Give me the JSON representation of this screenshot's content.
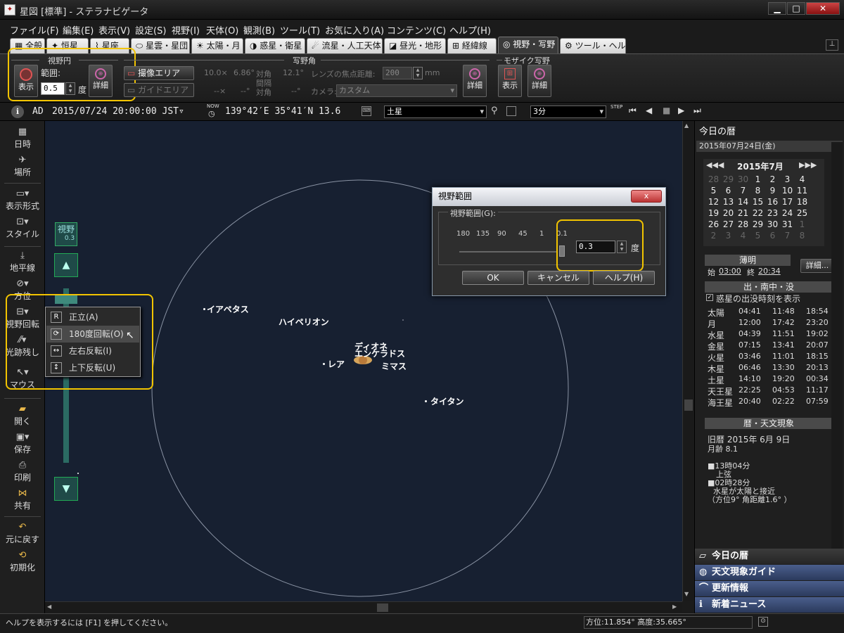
{
  "window": {
    "title": "星図 [標準] - ステラナビゲータ",
    "min": "▁",
    "max": "□",
    "close": "✕"
  },
  "menu": [
    "ファイル(F)",
    "編集(E)",
    "表示(V)",
    "設定(S)",
    "視野(I)",
    "天体(O)",
    "観測(B)",
    "ツール(T)",
    "お気に入り(A)",
    "コンテンツ(C)",
    "ヘルプ(H)"
  ],
  "tabs": [
    "全般",
    "恒星",
    "星座",
    "星雲・星団",
    "太陽・月",
    "惑星・衛星",
    "流星・人工天体",
    "昼光・地形",
    "経緯線",
    "視野・写野",
    "ツール・ヘルプ"
  ],
  "ribbon": {
    "fov_circle": {
      "title": "視野円",
      "show": "表示",
      "range_label": "範囲:",
      "range_value": "0.5",
      "unit": "度",
      "detail": "詳細"
    },
    "photo": {
      "title": "写野角",
      "imaging_area": "撮像エリア",
      "guide_area": "ガイドエリア",
      "v1": "10.0×",
      "v2": "6.86°",
      "v3": "対角",
      "v4": "12.1°",
      "d1": "--×",
      "d2": "--°",
      "d3": "間隔",
      "d3b": "対角",
      "d4": "--°",
      "focal_label": "レンズの焦点距離:",
      "focal_value": "200",
      "focal_unit": "mm",
      "camera_label": "カメラ:",
      "camera_value": "カスタム",
      "detail": "詳細"
    },
    "mosaic": {
      "title": "モザイク写野",
      "show": "表示",
      "detail": "詳細"
    }
  },
  "status_row": {
    "era": "AD",
    "datetime": "2015/07/24 20:00:00 JST▿",
    "now": "NOW",
    "coords": "139°42′E 35°41′N 13.6",
    "object": "土星",
    "step": "3分",
    "step_label": "STEP"
  },
  "left_tools": [
    "日時",
    "場所",
    "表示形式",
    "スタイル",
    "地平線",
    "方位",
    "視野回転",
    "光跡残し",
    "マウス",
    "開く",
    "保存",
    "印刷",
    "共有",
    "元に戻す",
    "初期化"
  ],
  "view_slider": {
    "label": "視野",
    "value": "0.3"
  },
  "sky_labels": [
    {
      "name": "イアペタス"
    },
    {
      "name": "ハイペリオン"
    },
    {
      "name": "ディオネ"
    },
    {
      "name": "エンケラドス"
    },
    {
      "name": "レア"
    },
    {
      "name": "ミマス"
    },
    {
      "name": "タイタン"
    }
  ],
  "context_menu": [
    {
      "label": "正立(A)",
      "icon": "upright-icon"
    },
    {
      "label": "180度回転(O)",
      "icon": "rotate-180-icon"
    },
    {
      "label": "左右反転(I)",
      "icon": "flip-horizontal-icon"
    },
    {
      "label": "上下反転(U)",
      "icon": "flip-vertical-icon"
    }
  ],
  "dialog": {
    "title": "視野範囲",
    "group": "視野範囲(G):",
    "ticks": [
      "180",
      "135",
      "90",
      "45",
      "1",
      "0.1"
    ],
    "value": "0.3",
    "unit": "度",
    "ok": "OK",
    "cancel": "キャンセル",
    "help": "ヘルプ(H)",
    "close": "x"
  },
  "right": {
    "title": "今日の暦",
    "date": "2015年07月24日(金)",
    "month": "2015年7月",
    "calendar": [
      [
        "28",
        "29",
        "30",
        "1",
        "2",
        "3",
        "4"
      ],
      [
        "5",
        "6",
        "7",
        "8",
        "9",
        "10",
        "11"
      ],
      [
        "12",
        "13",
        "14",
        "15",
        "16",
        "17",
        "18"
      ],
      [
        "19",
        "20",
        "21",
        "22",
        "23",
        "24",
        "25"
      ],
      [
        "26",
        "27",
        "28",
        "29",
        "30",
        "31",
        "1"
      ],
      [
        "2",
        "3",
        "4",
        "5",
        "6",
        "7",
        "8"
      ]
    ],
    "twilight_title": "薄明",
    "twilight_start_label": "始",
    "twilight_start": "03:00",
    "twilight_end_label": "終",
    "twilight_end": "20:34",
    "detail": "詳細...",
    "rise_title": "出・南中・没",
    "rise_check": "惑星の出没時刻を表示",
    "rise": [
      [
        "太陽",
        "04:41",
        "11:48",
        "18:54"
      ],
      [
        "月",
        "12:00",
        "17:42",
        "23:20"
      ],
      [
        "水星",
        "04:39",
        "11:51",
        "19:02"
      ],
      [
        "金星",
        "07:15",
        "13:41",
        "20:07"
      ],
      [
        "火星",
        "03:46",
        "11:01",
        "18:15"
      ],
      [
        "木星",
        "06:46",
        "13:30",
        "20:13"
      ],
      [
        "土星",
        "14:10",
        "19:20",
        "00:34"
      ],
      [
        "天王星",
        "22:25",
        "04:53",
        "11:17"
      ],
      [
        "海王星",
        "20:40",
        "02:22",
        "07:59"
      ]
    ],
    "cal_title": "暦・天文現象",
    "lunar": "旧暦 2015年 6月 9日",
    "moon_age": "月齢 8.1",
    "ev1": "■13時04分",
    "ev1b": "上弦",
    "ev2": "■02時28分",
    "ev2b": "水星が太陽と接近",
    "ev2c": "（方位9° 角距離1.6° ）",
    "nav": [
      "今日の暦",
      "天文現象ガイド",
      "更新情報",
      "新着ニュース"
    ]
  },
  "statusbar": {
    "help": "ヘルプを表示するには [F1] を押してください。",
    "pos": "方位:11.854° 高度:35.665°"
  },
  "colors": {
    "highlight": "#f2c400",
    "sky": "#172031"
  }
}
